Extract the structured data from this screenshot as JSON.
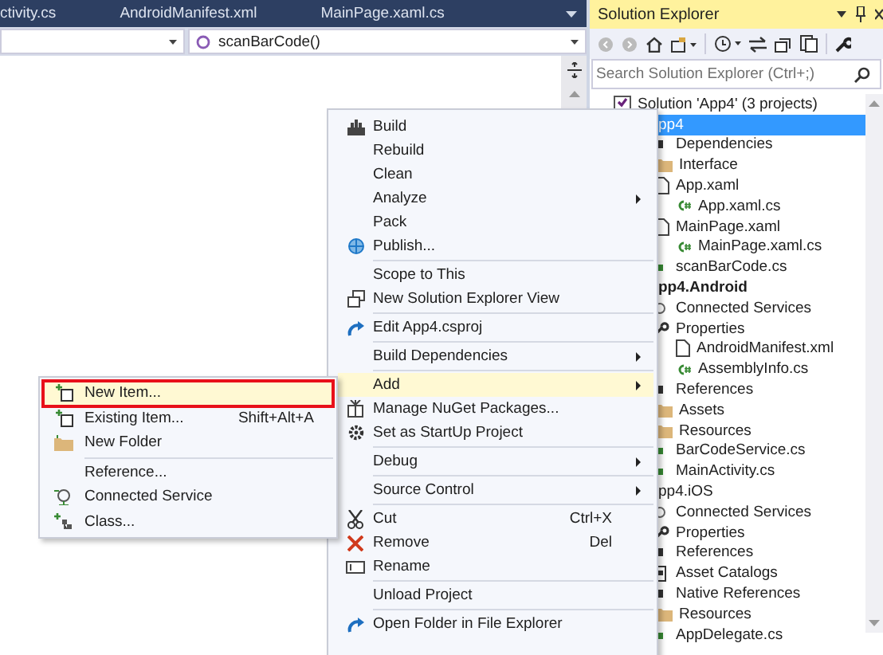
{
  "editor": {
    "tabs": [
      {
        "label": "ctivity.cs",
        "selected": false
      },
      {
        "label": "AndroidManifest.xml",
        "selected": false
      },
      {
        "label": "MainPage.xaml.cs",
        "selected": false
      }
    ],
    "member_dropdown": {
      "value": "scanBarCode()"
    }
  },
  "solution_explorer": {
    "title": "Solution Explorer",
    "search": {
      "placeholder": "Search Solution Explorer (Ctrl+;)"
    },
    "tree": [
      {
        "label": "Solution 'App4' (3 projects)",
        "kind": "solution",
        "selected": false,
        "children": [
          {
            "label": "pp4",
            "kind": "project",
            "selected": true,
            "startup": false,
            "children": [
              {
                "label": "Dependencies",
                "kind": "dependencies",
                "selected": false
              },
              {
                "label": "Interface",
                "kind": "folder",
                "selected": false
              },
              {
                "label": "App.xaml",
                "kind": "page",
                "selected": false,
                "children": [
                  {
                    "label": "App.xaml.cs",
                    "kind": "csharp",
                    "selected": false
                  }
                ]
              },
              {
                "label": "MainPage.xaml",
                "kind": "page",
                "selected": false,
                "children": [
                  {
                    "label": "MainPage.xaml.cs",
                    "kind": "csharp",
                    "selected": false
                  }
                ]
              },
              {
                "label": "scanBarCode.cs",
                "kind": "code",
                "selected": false
              }
            ]
          },
          {
            "label": "pp4.Android",
            "kind": "project",
            "selected": false,
            "startup": true,
            "children": [
              {
                "label": "Connected Services",
                "kind": "connected",
                "selected": false
              },
              {
                "label": "Properties",
                "kind": "properties",
                "selected": false,
                "children": [
                  {
                    "label": "AndroidManifest.xml",
                    "kind": "page",
                    "selected": false
                  },
                  {
                    "label": "AssemblyInfo.cs",
                    "kind": "csharp",
                    "selected": false
                  }
                ]
              },
              {
                "label": "References",
                "kind": "references",
                "selected": false
              },
              {
                "label": "Assets",
                "kind": "folder",
                "selected": false
              },
              {
                "label": "Resources",
                "kind": "folder",
                "selected": false
              },
              {
                "label": "BarCodeService.cs",
                "kind": "code",
                "selected": false
              },
              {
                "label": "MainActivity.cs",
                "kind": "code",
                "selected": false
              }
            ]
          },
          {
            "label": "pp4.iOS",
            "kind": "project",
            "selected": false,
            "startup": false,
            "children": [
              {
                "label": "Connected Services",
                "kind": "connected",
                "selected": false
              },
              {
                "label": "Properties",
                "kind": "properties",
                "selected": false
              },
              {
                "label": "References",
                "kind": "references",
                "selected": false
              },
              {
                "label": "Asset Catalogs",
                "kind": "catalog",
                "selected": false
              },
              {
                "label": "Native References",
                "kind": "references",
                "selected": false
              },
              {
                "label": "Resources",
                "kind": "folder",
                "selected": false
              },
              {
                "label": "AppDelegate.cs",
                "kind": "code",
                "selected": false
              }
            ]
          }
        ]
      }
    ]
  },
  "context_menu": [
    {
      "kind": "item",
      "label": "Build",
      "selected": false,
      "submenu": false
    },
    {
      "kind": "item",
      "label": "Rebuild",
      "selected": false,
      "submenu": false
    },
    {
      "kind": "item",
      "label": "Clean",
      "selected": false,
      "submenu": false
    },
    {
      "kind": "item",
      "label": "Analyze",
      "selected": false,
      "submenu": true
    },
    {
      "kind": "item",
      "label": "Pack",
      "selected": false,
      "submenu": false
    },
    {
      "kind": "item",
      "label": "Publish...",
      "selected": false,
      "submenu": false
    },
    {
      "kind": "separator"
    },
    {
      "kind": "item",
      "label": "Scope to This",
      "selected": false,
      "submenu": false
    },
    {
      "kind": "item",
      "label": "New Solution Explorer View",
      "selected": false,
      "submenu": false
    },
    {
      "kind": "separator"
    },
    {
      "kind": "item",
      "label": "Edit App4.csproj",
      "selected": false,
      "submenu": false
    },
    {
      "kind": "separator"
    },
    {
      "kind": "item",
      "label": "Build Dependencies",
      "selected": false,
      "submenu": true
    },
    {
      "kind": "separator"
    },
    {
      "kind": "item",
      "label": "Add",
      "selected": true,
      "submenu": true
    },
    {
      "kind": "item",
      "label": "Manage NuGet Packages...",
      "selected": false,
      "submenu": false
    },
    {
      "kind": "item",
      "label": "Set as StartUp Project",
      "selected": false,
      "submenu": false
    },
    {
      "kind": "separator"
    },
    {
      "kind": "item",
      "label": "Debug",
      "selected": false,
      "submenu": true
    },
    {
      "kind": "separator"
    },
    {
      "kind": "item",
      "label": "Source Control",
      "selected": false,
      "submenu": true
    },
    {
      "kind": "separator"
    },
    {
      "kind": "item",
      "label": "Cut",
      "shortcut": "Ctrl+X",
      "selected": false,
      "submenu": false
    },
    {
      "kind": "item",
      "label": "Remove",
      "shortcut": "Del",
      "selected": false,
      "submenu": false
    },
    {
      "kind": "item",
      "label": "Rename",
      "selected": false,
      "submenu": false
    },
    {
      "kind": "separator"
    },
    {
      "kind": "item",
      "label": "Unload Project",
      "selected": false,
      "submenu": false
    },
    {
      "kind": "separator"
    },
    {
      "kind": "item",
      "label": "Open Folder in File Explorer",
      "selected": false,
      "submenu": false
    }
  ],
  "add_submenu": [
    {
      "kind": "item",
      "label": "New Item...",
      "selected": true
    },
    {
      "kind": "item",
      "label": "Existing Item...",
      "shortcut": "Shift+Alt+A",
      "selected": false
    },
    {
      "kind": "item",
      "label": "New Folder",
      "selected": false
    },
    {
      "kind": "separator"
    },
    {
      "kind": "item",
      "label": "Reference...",
      "selected": false
    },
    {
      "kind": "item",
      "label": "Connected Service",
      "selected": false
    },
    {
      "kind": "item",
      "label": "Class...",
      "selected": false
    }
  ]
}
